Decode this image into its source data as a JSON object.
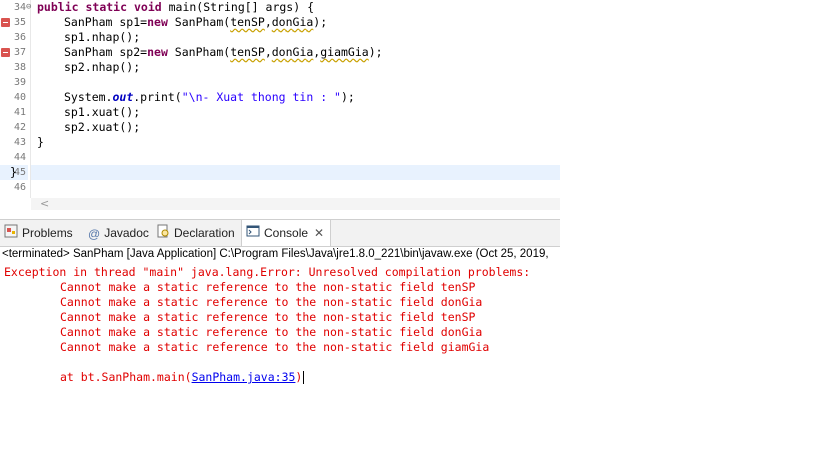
{
  "editor": {
    "line_numbers": [
      "34",
      "35",
      "36",
      "37",
      "38",
      "39",
      "40",
      "41",
      "42",
      "43",
      "44",
      "45",
      "46"
    ],
    "lines": {
      "l34": {
        "kw1": "public",
        "kw2": "static",
        "kw3": "void",
        "rest": " main(String[] args) {"
      },
      "l35": {
        "a": "SanPham sp1=",
        "kw": "new",
        "b": " SanPham(",
        "w1": "tenSP",
        "c": ",",
        "w2": "donGia",
        "d": ");"
      },
      "l36": {
        "text": "sp1.nhap();"
      },
      "l37": {
        "a": "SanPham sp2=",
        "kw": "new",
        "b": " SanPham(",
        "w1": "tenSP",
        "c": ",",
        "w2": "donGia",
        "c2": ",",
        "w3": "giamGia",
        "d": ");"
      },
      "l38": {
        "text": "sp2.nhap();"
      },
      "l40": {
        "a": "System.",
        "fld": "out",
        "b": ".print(",
        "str": "\"\\n- Xuat thong tin : \"",
        "c": ");"
      },
      "l41": {
        "text": "sp1.xuat();"
      },
      "l42": {
        "text": "sp2.xuat();"
      },
      "l43": {
        "text": "}"
      },
      "l45": {
        "text": "}"
      }
    },
    "scroll_arrow": "<"
  },
  "tabs": [
    {
      "label": "Problems",
      "icon": "problems-icon"
    },
    {
      "label": "Javadoc",
      "icon": "javadoc-icon",
      "glyph": "@"
    },
    {
      "label": "Declaration",
      "icon": "declaration-icon"
    },
    {
      "label": "Console",
      "icon": "console-icon",
      "close": "✕"
    }
  ],
  "console": {
    "header": "<terminated> SanPham [Java Application] C:\\Program Files\\Java\\jre1.8.0_221\\bin\\javaw.exe (Oct 25, 2019,",
    "lines": [
      "Exception in thread \"main\" java.lang.Error: Unresolved compilation problems: ",
      "\tCannot make a static reference to the non-static field tenSP",
      "\tCannot make a static reference to the non-static field donGia",
      "\tCannot make a static reference to the non-static field tenSP",
      "\tCannot make a static reference to the non-static field donGia",
      "\tCannot make a static reference to the non-static field giamGia"
    ],
    "stack_prefix": "\tat bt.SanPham.main(",
    "stack_link": "SanPham.java:35",
    "stack_suffix": ")"
  },
  "colors": {
    "error": "#e00000",
    "keyword": "#7f0055",
    "string": "#2a00ff",
    "link": "#0000ee"
  }
}
